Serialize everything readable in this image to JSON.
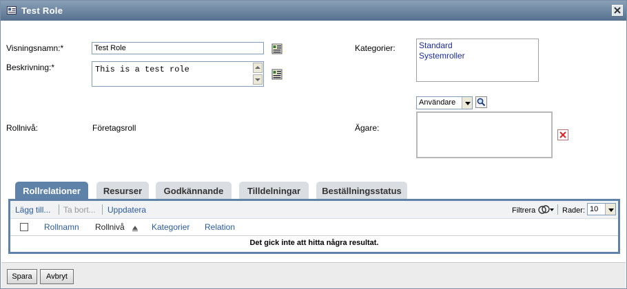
{
  "dialog": {
    "title": "Test Role",
    "icon": "role-icon",
    "close_icon": "close-icon"
  },
  "form": {
    "display_name_label": "Visningsnamn:*",
    "display_name_value": "Test Role",
    "description_label": "Beskrivning:*",
    "description_value": "This is a test role",
    "role_level_label": "Rollnivå:",
    "role_level_value": "Företagsroll",
    "categories_label": "Kategorier:",
    "categories_options": [
      "Standard",
      "Systemroller"
    ],
    "owner_label": "Ägare:",
    "owner_type_selected": "Användare",
    "owner_search_icon": "search-icon",
    "owner_remove_icon": "remove-icon",
    "localize_icon": "localize-icon"
  },
  "tabs": [
    {
      "label": "Rollrelationer",
      "active": true
    },
    {
      "label": "Resurser",
      "active": false
    },
    {
      "label": "Godkännande",
      "active": false
    },
    {
      "label": "Tilldelningar",
      "active": false
    },
    {
      "label": "Beställningsstatus",
      "active": false
    }
  ],
  "toolbar": {
    "add_label": "Lägg till...",
    "remove_label": "Ta bort...",
    "refresh_label": "Uppdatera",
    "filter_label": "Filtrera",
    "rows_label": "Rader:",
    "rows_value": "10"
  },
  "table": {
    "columns": [
      "Rollnamn",
      "Rollnivå",
      "Kategorier",
      "Relation"
    ],
    "sorted_column": "Rollnivå",
    "empty_message": "Det gick inte att hitta några resultat."
  },
  "footer": {
    "save_label": "Spara",
    "cancel_label": "Avbryt"
  },
  "colors": {
    "title_bar": "#56708e",
    "active_tab": "#5e82a8",
    "link": "#2a5a9c"
  }
}
